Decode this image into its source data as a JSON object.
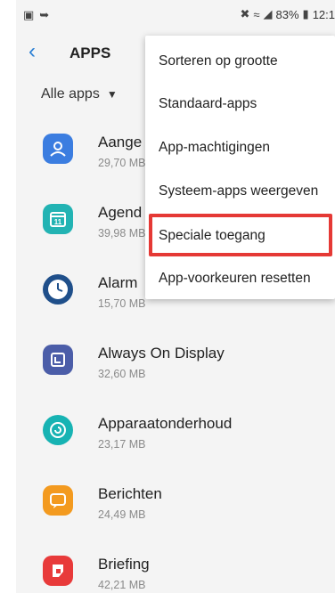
{
  "status_bar": {
    "battery": "83%",
    "time": "12:1"
  },
  "appbar": {
    "title": "APPS"
  },
  "filter": {
    "label": "Alle apps"
  },
  "apps": [
    {
      "name": "Aange",
      "size": "29,70 MB",
      "icon": "contacts-icon",
      "color": "#3b7de0"
    },
    {
      "name": "Agend",
      "size": "39,98 MB",
      "icon": "calendar-icon",
      "color": "#22b3b3"
    },
    {
      "name": "Alarm",
      "size": "15,70 MB",
      "icon": "clock-icon",
      "color": "#1f4f8a"
    },
    {
      "name": "Always On Display",
      "size": "32,60 MB",
      "icon": "always-on-display-icon",
      "color": "#4b5da8"
    },
    {
      "name": "Apparaatonderhoud",
      "size": "23,17 MB",
      "icon": "device-care-icon",
      "color": "#17b3b3"
    },
    {
      "name": "Berichten",
      "size": "24,49 MB",
      "icon": "messages-icon",
      "color": "#f39a1f"
    },
    {
      "name": "Briefing",
      "size": "42,21 MB",
      "icon": "briefing-icon",
      "color": "#e83a3a"
    }
  ],
  "menu": {
    "items": [
      "Sorteren op grootte",
      "Standaard-apps",
      "App-machtigingen",
      "Systeem-apps weergeven",
      "Speciale toegang",
      "App-voorkeuren resetten"
    ]
  },
  "colors": {
    "accent": "#2a7fd4",
    "highlight": "#e53935"
  }
}
